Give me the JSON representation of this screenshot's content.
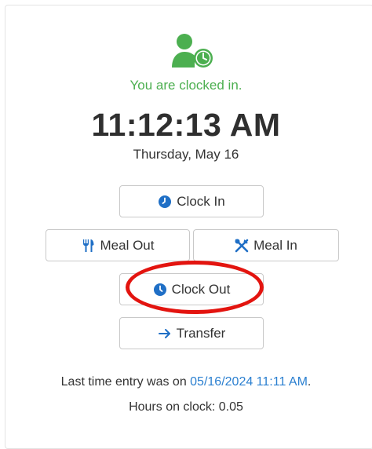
{
  "status": {
    "text": "You are clocked in.",
    "icon": "user-clock-icon",
    "color": "#4caf50"
  },
  "clock": {
    "time": "11:12:13 AM",
    "date": "Thursday, May 16"
  },
  "buttons": {
    "clock_in": {
      "label": "Clock In",
      "icon": "clock-icon"
    },
    "meal_out": {
      "label": "Meal Out",
      "icon": "utensils-icon"
    },
    "meal_in": {
      "label": "Meal In",
      "icon": "utensils-crossed-icon"
    },
    "clock_out": {
      "label": "Clock Out",
      "icon": "clock-icon"
    },
    "transfer": {
      "label": "Transfer",
      "icon": "arrow-right-icon"
    }
  },
  "accent_color": "#1f6fc6",
  "highlight_color": "#e3140f",
  "footer": {
    "last_entry_prefix": "Last time entry was on ",
    "last_entry_link": "05/16/2024 11:11 AM",
    "last_entry_suffix": ".",
    "hours_on_clock": "Hours on clock: 0.05"
  }
}
